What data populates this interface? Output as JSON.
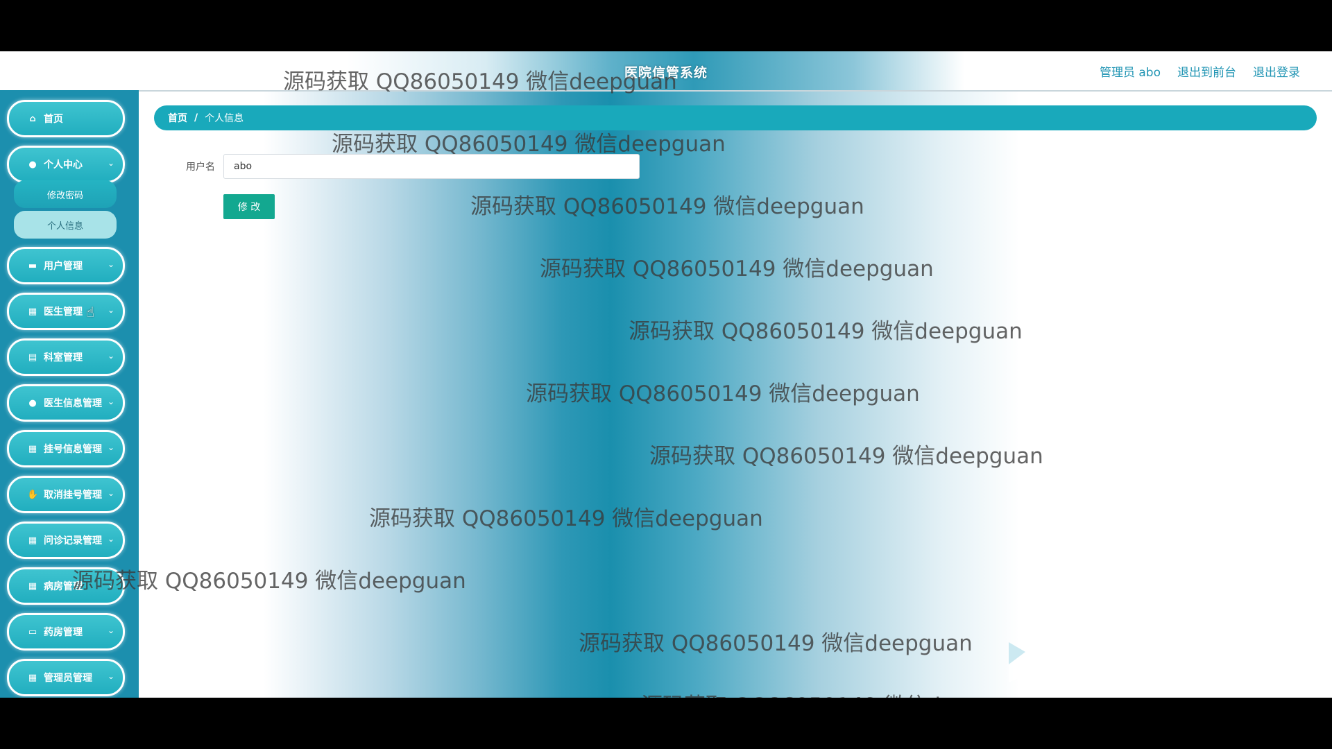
{
  "header": {
    "title": "医院信管系统",
    "links": [
      "管理员 abo",
      "退出到前台",
      "退出登录"
    ]
  },
  "sidebar": {
    "items": [
      {
        "label": "首页",
        "icon": "home-icon"
      },
      {
        "label": "个人中心",
        "icon": "user-icon",
        "expanded": true,
        "children": [
          "修改密码",
          "个人信息"
        ]
      },
      {
        "label": "用户管理",
        "icon": "briefcase-icon"
      },
      {
        "label": "医生管理",
        "icon": "grid-icon"
      },
      {
        "label": "科室管理",
        "icon": "clipboard-icon"
      },
      {
        "label": "医生信息管理",
        "icon": "user-icon"
      },
      {
        "label": "挂号信息管理",
        "icon": "grid-icon"
      },
      {
        "label": "取消挂号管理",
        "icon": "thumb-icon"
      },
      {
        "label": "问诊记录管理",
        "icon": "grid-icon"
      },
      {
        "label": "病房管理",
        "icon": "grid-icon"
      },
      {
        "label": "药房管理",
        "icon": "ticket-icon"
      },
      {
        "label": "管理员管理",
        "icon": "grid-icon"
      }
    ],
    "active_child": "个人信息"
  },
  "breadcrumb": {
    "home": "首页",
    "separator": "/",
    "current": "个人信息"
  },
  "form": {
    "username_label": "用户名",
    "username_value": "abo",
    "submit_label": "修 改"
  },
  "watermark_text": "源码获取 QQ86050149 微信deepguan",
  "colors": {
    "sidebar": "#1c8fae",
    "accent": "#19a9bb",
    "button": "#13a890",
    "link": "#1f94b3"
  }
}
